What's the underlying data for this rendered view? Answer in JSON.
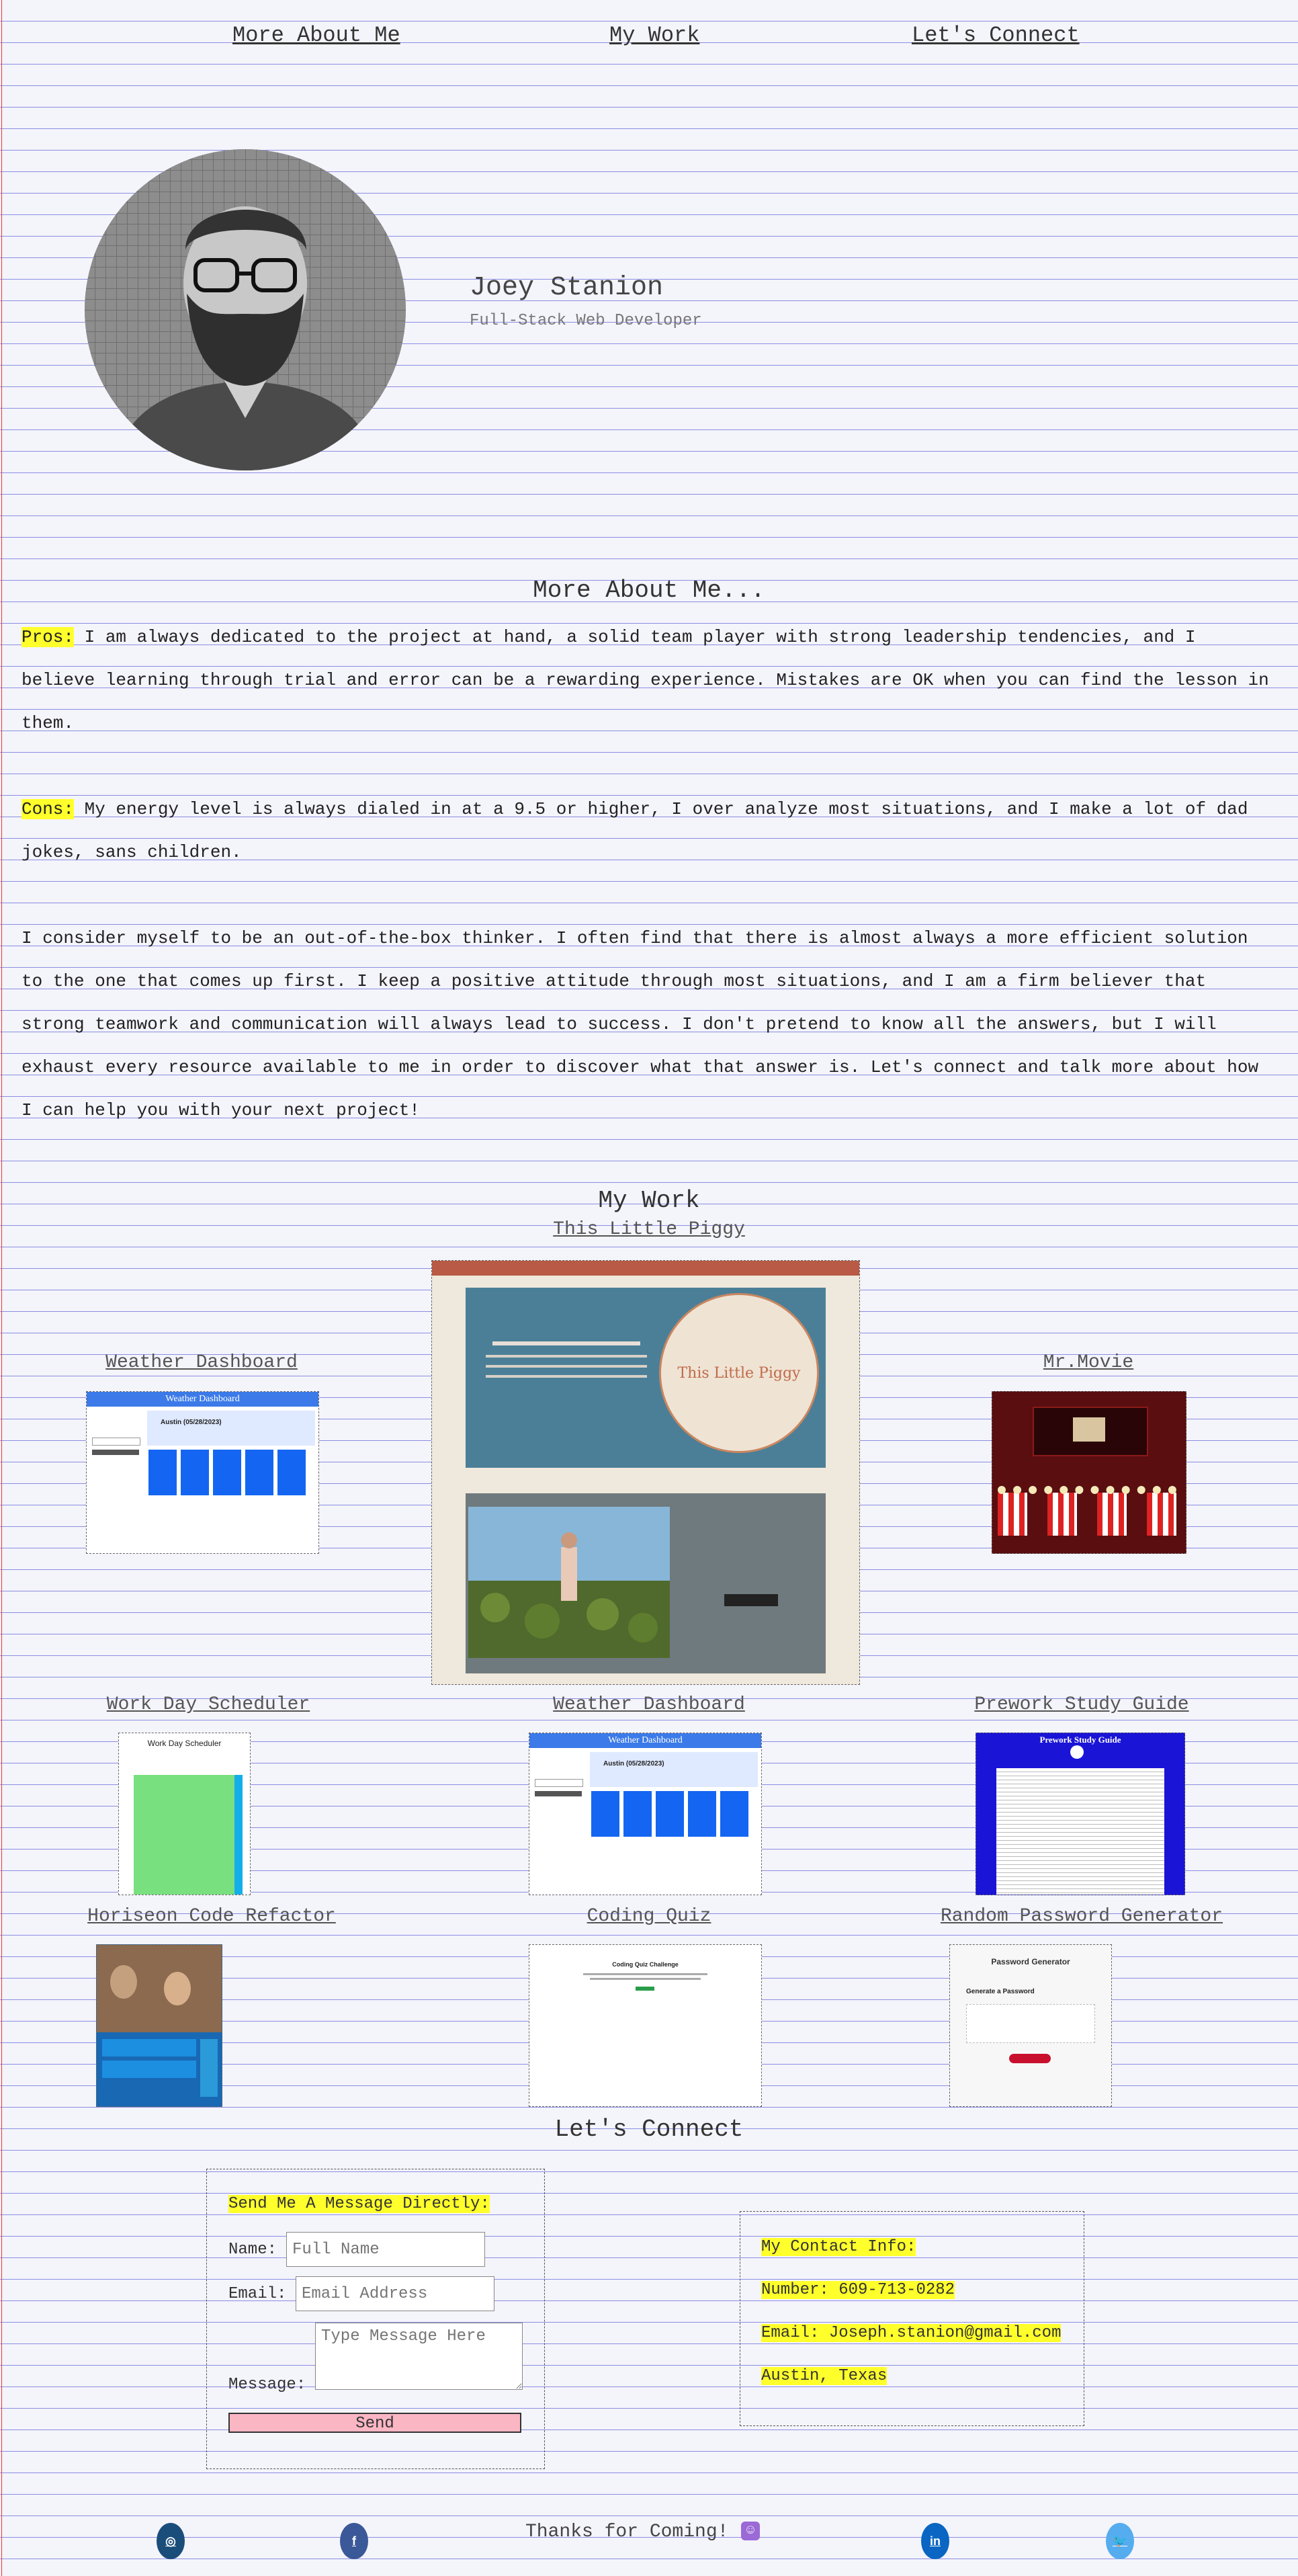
{
  "nav": [
    "More About Me",
    "My Work",
    "Let's Connect"
  ],
  "header": {
    "name": "Joey Stanion",
    "role": "Full-Stack Web Developer"
  },
  "about": {
    "title": "More About Me...",
    "pros_label": "Pros:",
    "pros_text": " I am always dedicated to the project at hand, a solid team player with strong leadership tendencies, and I believe learning through trial and error can be a rewarding experience. Mistakes are OK when you can find the lesson in them.",
    "cons_label": "Cons:",
    "cons_text": " My energy level is always dialed in at a 9.5 or higher, I over analyze most situations, and I make a lot of dad jokes, sans children.",
    "paragraph": "I consider myself to be an out-of-the-box thinker. I often find that there is almost always a more efficient solution to the one that comes up first. I keep a positive attitude through most situations, and I am a firm believer that strong teamwork and communication will always lead to success. I don't pretend to know all the answers, but I will exhaust every resource available to me in order to discover what that answer is. Let's connect and talk more about how I can help you with your next project!"
  },
  "work": {
    "title": "My Work",
    "projects": [
      "This Little Piggy",
      "Weather Dashboard",
      "Mr.Movie",
      "Work Day Scheduler",
      "Weather Dashboard",
      "Prework Study Guide",
      "Horiseon Code Refactor",
      "Coding Quiz",
      "Random Password Generator"
    ],
    "thumb_text": {
      "piggy_brand": "This Little Piggy",
      "weather_header": "Weather Dashboard",
      "weather_city": "Austin (05/28/2023)",
      "scheduler": "Work Day Scheduler",
      "prework": "Prework Study Guide",
      "quiz": "Coding Quiz Challenge",
      "password": "Password Generator",
      "password_sub": "Generate a Password"
    }
  },
  "connect": {
    "title": "Let's Connect",
    "form_title": "Send Me A Message Directly:",
    "name_label": "Name:",
    "name_placeholder": "Full Name",
    "email_label": "Email:",
    "email_placeholder": "Email Address",
    "message_label": "Message:",
    "message_placeholder": "Type Message Here",
    "send": "Send",
    "info_title": "My Contact Info:",
    "number": "Number: 609-713-0282",
    "email": "Email: Joseph.stanion@gmail.com",
    "location": "Austin, Texas"
  },
  "footer": {
    "thanks": "Thanks for Coming!",
    "social": [
      "instagram-icon",
      "facebook-icon",
      "linkedin-icon",
      "twitter-icon"
    ]
  },
  "colors": {
    "highlight": "#ffff2b",
    "ruled_line": "#8a8fe0",
    "margin_line": "#ee3333",
    "send_button": "#fbb6c4"
  }
}
